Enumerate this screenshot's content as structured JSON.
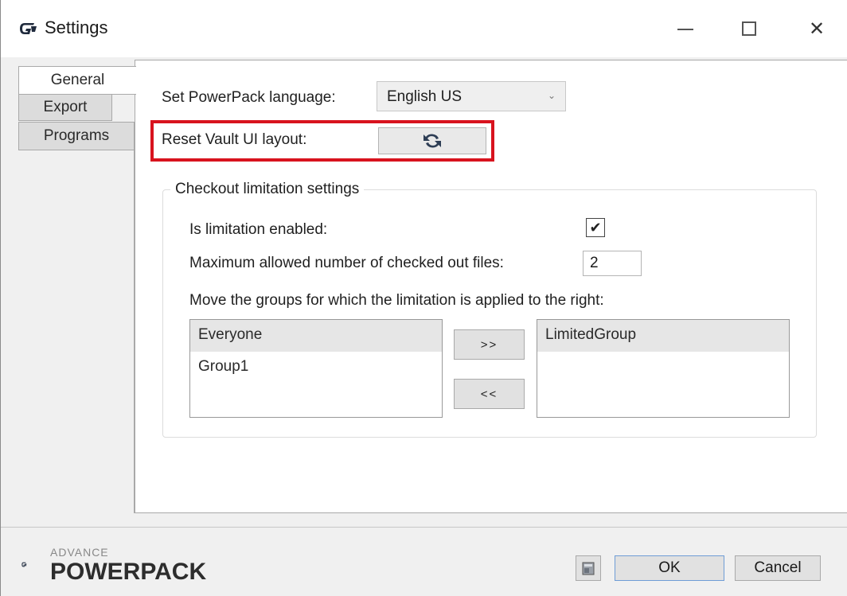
{
  "window": {
    "title": "Settings",
    "logo_icon": "advance-g-logo-icon",
    "minimize_icon": "minimize-icon",
    "maximize_icon": "maximize-icon",
    "close_icon": "close-icon",
    "close_glyph": "✕"
  },
  "tabs": [
    {
      "label": "General",
      "selected": true
    },
    {
      "label": "Export",
      "selected": false
    },
    {
      "label": "Programs",
      "selected": false
    }
  ],
  "general": {
    "language_label": "Set PowerPack language:",
    "language_value": "English US",
    "language_arrow": "⌄",
    "reset_label": "Reset Vault UI layout:",
    "reset_icon": "refresh-icon",
    "highlight_color": "#d8131e"
  },
  "checkout": {
    "group_title": "Checkout limitation settings",
    "enabled_label": "Is limitation enabled:",
    "enabled_checked": true,
    "check_glyph": "✔",
    "max_label": "Maximum allowed number of checked out files:",
    "max_value": "2",
    "groups_label": "Move the groups for which the limitation is applied to the right:",
    "available_groups": [
      "Everyone",
      "Group1"
    ],
    "limited_groups": [
      "LimitedGroup"
    ],
    "move_right_label": ">>",
    "move_left_label": "<<"
  },
  "footer": {
    "brand_small": "ADVANCE",
    "brand_big": "POWERPACK",
    "help_icon": "book-help-icon",
    "ok_label": "OK",
    "cancel_label": "Cancel"
  }
}
